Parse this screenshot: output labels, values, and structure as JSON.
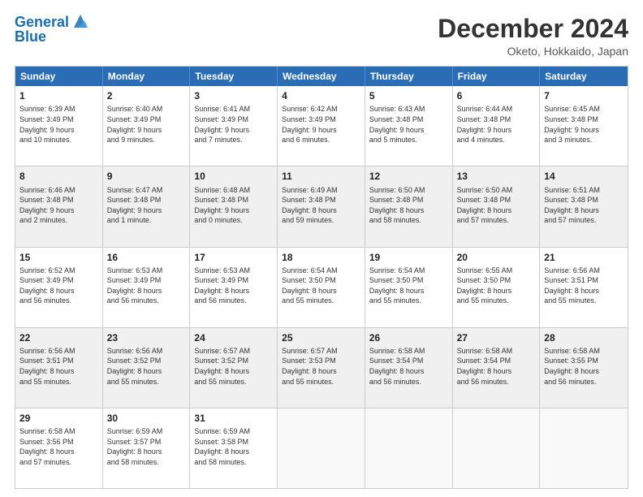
{
  "logo": {
    "line1": "General",
    "line2": "Blue"
  },
  "title": "December 2024",
  "subtitle": "Oketo, Hokkaido, Japan",
  "header": {
    "days": [
      "Sunday",
      "Monday",
      "Tuesday",
      "Wednesday",
      "Thursday",
      "Friday",
      "Saturday"
    ]
  },
  "weeks": [
    [
      {
        "day": "1",
        "info": "Sunrise: 6:39 AM\nSunset: 3:49 PM\nDaylight: 9 hours\nand 10 minutes.",
        "shaded": false,
        "empty": false
      },
      {
        "day": "2",
        "info": "Sunrise: 6:40 AM\nSunset: 3:49 PM\nDaylight: 9 hours\nand 9 minutes.",
        "shaded": false,
        "empty": false
      },
      {
        "day": "3",
        "info": "Sunrise: 6:41 AM\nSunset: 3:49 PM\nDaylight: 9 hours\nand 7 minutes.",
        "shaded": false,
        "empty": false
      },
      {
        "day": "4",
        "info": "Sunrise: 6:42 AM\nSunset: 3:49 PM\nDaylight: 9 hours\nand 6 minutes.",
        "shaded": false,
        "empty": false
      },
      {
        "day": "5",
        "info": "Sunrise: 6:43 AM\nSunset: 3:48 PM\nDaylight: 9 hours\nand 5 minutes.",
        "shaded": false,
        "empty": false
      },
      {
        "day": "6",
        "info": "Sunrise: 6:44 AM\nSunset: 3:48 PM\nDaylight: 9 hours\nand 4 minutes.",
        "shaded": false,
        "empty": false
      },
      {
        "day": "7",
        "info": "Sunrise: 6:45 AM\nSunset: 3:48 PM\nDaylight: 9 hours\nand 3 minutes.",
        "shaded": false,
        "empty": false
      }
    ],
    [
      {
        "day": "8",
        "info": "Sunrise: 6:46 AM\nSunset: 3:48 PM\nDaylight: 9 hours\nand 2 minutes.",
        "shaded": true,
        "empty": false
      },
      {
        "day": "9",
        "info": "Sunrise: 6:47 AM\nSunset: 3:48 PM\nDaylight: 9 hours\nand 1 minute.",
        "shaded": true,
        "empty": false
      },
      {
        "day": "10",
        "info": "Sunrise: 6:48 AM\nSunset: 3:48 PM\nDaylight: 9 hours\nand 0 minutes.",
        "shaded": true,
        "empty": false
      },
      {
        "day": "11",
        "info": "Sunrise: 6:49 AM\nSunset: 3:48 PM\nDaylight: 8 hours\nand 59 minutes.",
        "shaded": true,
        "empty": false
      },
      {
        "day": "12",
        "info": "Sunrise: 6:50 AM\nSunset: 3:48 PM\nDaylight: 8 hours\nand 58 minutes.",
        "shaded": true,
        "empty": false
      },
      {
        "day": "13",
        "info": "Sunrise: 6:50 AM\nSunset: 3:48 PM\nDaylight: 8 hours\nand 57 minutes.",
        "shaded": true,
        "empty": false
      },
      {
        "day": "14",
        "info": "Sunrise: 6:51 AM\nSunset: 3:48 PM\nDaylight: 8 hours\nand 57 minutes.",
        "shaded": true,
        "empty": false
      }
    ],
    [
      {
        "day": "15",
        "info": "Sunrise: 6:52 AM\nSunset: 3:49 PM\nDaylight: 8 hours\nand 56 minutes.",
        "shaded": false,
        "empty": false
      },
      {
        "day": "16",
        "info": "Sunrise: 6:53 AM\nSunset: 3:49 PM\nDaylight: 8 hours\nand 56 minutes.",
        "shaded": false,
        "empty": false
      },
      {
        "day": "17",
        "info": "Sunrise: 6:53 AM\nSunset: 3:49 PM\nDaylight: 8 hours\nand 56 minutes.",
        "shaded": false,
        "empty": false
      },
      {
        "day": "18",
        "info": "Sunrise: 6:54 AM\nSunset: 3:50 PM\nDaylight: 8 hours\nand 55 minutes.",
        "shaded": false,
        "empty": false
      },
      {
        "day": "19",
        "info": "Sunrise: 6:54 AM\nSunset: 3:50 PM\nDaylight: 8 hours\nand 55 minutes.",
        "shaded": false,
        "empty": false
      },
      {
        "day": "20",
        "info": "Sunrise: 6:55 AM\nSunset: 3:50 PM\nDaylight: 8 hours\nand 55 minutes.",
        "shaded": false,
        "empty": false
      },
      {
        "day": "21",
        "info": "Sunrise: 6:56 AM\nSunset: 3:51 PM\nDaylight: 8 hours\nand 55 minutes.",
        "shaded": false,
        "empty": false
      }
    ],
    [
      {
        "day": "22",
        "info": "Sunrise: 6:56 AM\nSunset: 3:51 PM\nDaylight: 8 hours\nand 55 minutes.",
        "shaded": true,
        "empty": false
      },
      {
        "day": "23",
        "info": "Sunrise: 6:56 AM\nSunset: 3:52 PM\nDaylight: 8 hours\nand 55 minutes.",
        "shaded": true,
        "empty": false
      },
      {
        "day": "24",
        "info": "Sunrise: 6:57 AM\nSunset: 3:52 PM\nDaylight: 8 hours\nand 55 minutes.",
        "shaded": true,
        "empty": false
      },
      {
        "day": "25",
        "info": "Sunrise: 6:57 AM\nSunset: 3:53 PM\nDaylight: 8 hours\nand 55 minutes.",
        "shaded": true,
        "empty": false
      },
      {
        "day": "26",
        "info": "Sunrise: 6:58 AM\nSunset: 3:54 PM\nDaylight: 8 hours\nand 56 minutes.",
        "shaded": true,
        "empty": false
      },
      {
        "day": "27",
        "info": "Sunrise: 6:58 AM\nSunset: 3:54 PM\nDaylight: 8 hours\nand 56 minutes.",
        "shaded": true,
        "empty": false
      },
      {
        "day": "28",
        "info": "Sunrise: 6:58 AM\nSunset: 3:55 PM\nDaylight: 8 hours\nand 56 minutes.",
        "shaded": true,
        "empty": false
      }
    ],
    [
      {
        "day": "29",
        "info": "Sunrise: 6:58 AM\nSunset: 3:56 PM\nDaylight: 8 hours\nand 57 minutes.",
        "shaded": false,
        "empty": false
      },
      {
        "day": "30",
        "info": "Sunrise: 6:59 AM\nSunset: 3:57 PM\nDaylight: 8 hours\nand 58 minutes.",
        "shaded": false,
        "empty": false
      },
      {
        "day": "31",
        "info": "Sunrise: 6:59 AM\nSunset: 3:58 PM\nDaylight: 8 hours\nand 58 minutes.",
        "shaded": false,
        "empty": false
      },
      {
        "day": "",
        "info": "",
        "shaded": false,
        "empty": true
      },
      {
        "day": "",
        "info": "",
        "shaded": false,
        "empty": true
      },
      {
        "day": "",
        "info": "",
        "shaded": false,
        "empty": true
      },
      {
        "day": "",
        "info": "",
        "shaded": false,
        "empty": true
      }
    ]
  ]
}
